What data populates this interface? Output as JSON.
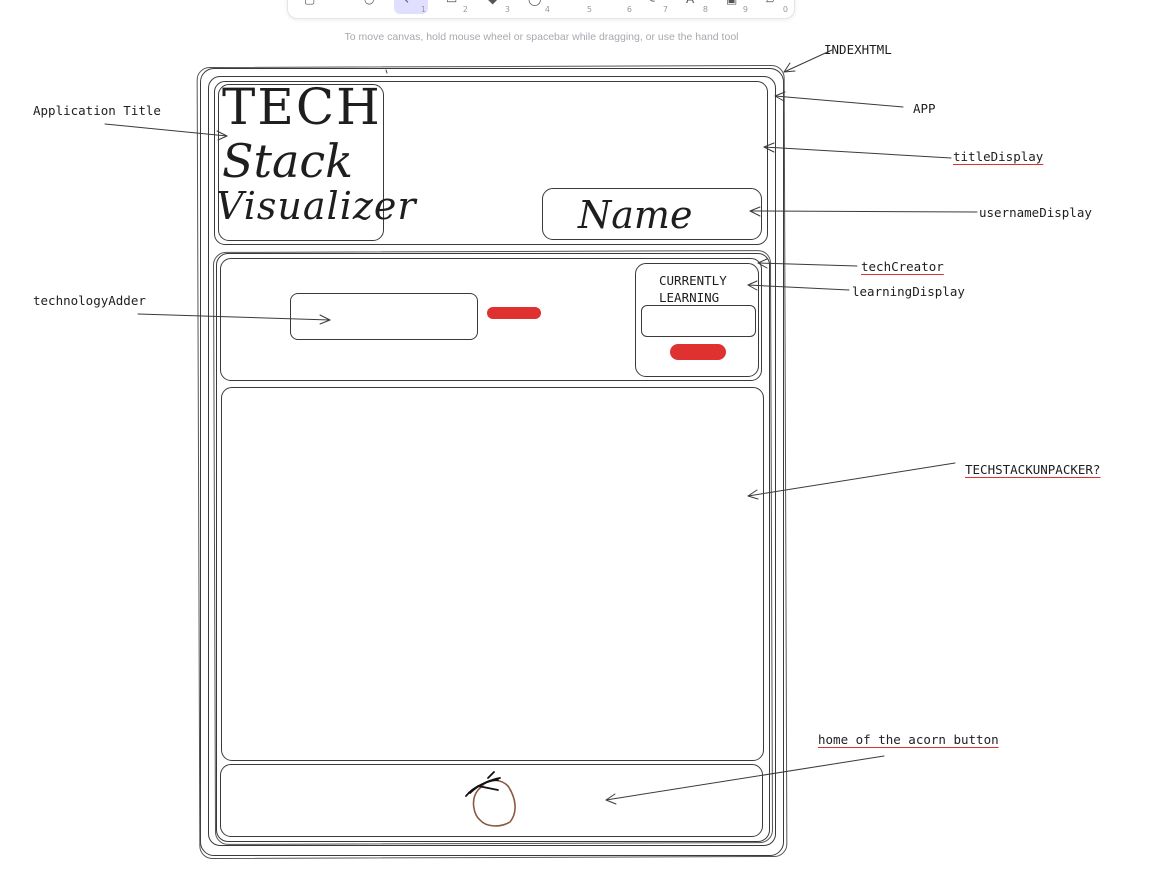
{
  "toolbar": {
    "tools": [
      {
        "name": "lock-icon",
        "glyph": "▢",
        "num": ""
      },
      {
        "name": "hand-icon",
        "glyph": "○",
        "num": ""
      },
      {
        "name": "selection-icon",
        "glyph": "↖",
        "num": "1"
      },
      {
        "name": "rectangle-icon",
        "glyph": "▭",
        "num": "2"
      },
      {
        "name": "diamond-icon",
        "glyph": "◆",
        "num": "3"
      },
      {
        "name": "ellipse-icon",
        "glyph": "◯",
        "num": "4"
      },
      {
        "name": "arrow-icon",
        "glyph": "",
        "num": "5"
      },
      {
        "name": "line-icon",
        "glyph": "",
        "num": "6"
      },
      {
        "name": "pencil-icon",
        "glyph": "✎",
        "num": "7"
      },
      {
        "name": "text-icon",
        "glyph": "A",
        "num": "8"
      },
      {
        "name": "image-icon",
        "glyph": "▣",
        "num": "9"
      },
      {
        "name": "eraser-icon",
        "glyph": "▱",
        "num": "0"
      }
    ],
    "hint": "To move canvas, hold mouse wheel or spacebar while dragging, or use the hand tool"
  },
  "sketch": {
    "title_line1": "TECH",
    "title_line2": "Stack",
    "title_line3": "Visualizer",
    "name_text": "Name",
    "learning_line1": "CURRENTLY",
    "learning_line2": "LEARNING"
  },
  "labels": {
    "indexhtml": "INDEXHTML",
    "app": "APP",
    "application_title": "Application Title",
    "title_display": "titleDisplay",
    "username_display": "usernameDisplay",
    "tech_creator": "techCreator",
    "learning_display": "learningDisplay",
    "technology_adder": "technologyAdder",
    "unpacker": "TECHSTACKUNPACKER?",
    "acorn_home": "home of the acorn button"
  },
  "colors": {
    "stroke": "#1e1e1e",
    "accent_red": "#e03131",
    "acorn_brown": "#8a5a44"
  }
}
